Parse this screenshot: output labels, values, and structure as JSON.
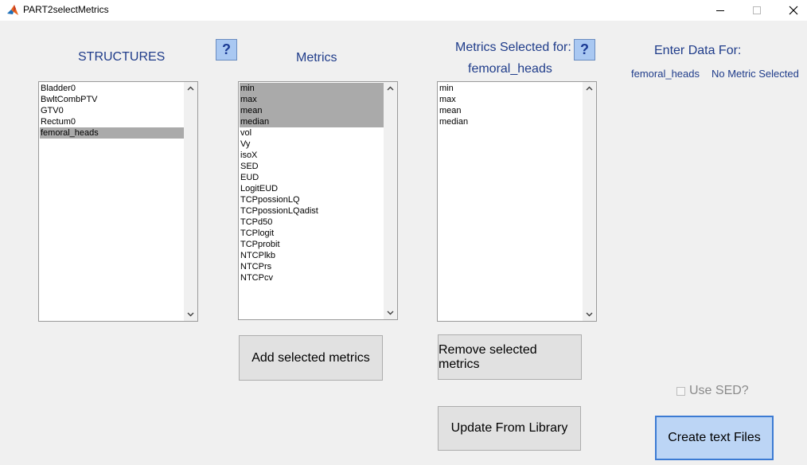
{
  "window": {
    "title": "PART2selectMetrics"
  },
  "labels": {
    "structures": "STRUCTURES",
    "metrics": "Metrics",
    "metrics_selected_for": "Metrics Selected for:",
    "selected_structure": "femoral_heads",
    "enter_data_for": "Enter Data For:",
    "enter_structure": "femoral_heads",
    "no_metric": "No Metric Selected"
  },
  "help": {
    "label": "?"
  },
  "structures_list": {
    "items": [
      "Bladder0",
      "BwltCombPTV",
      "GTV0",
      "Rectum0",
      "femoral_heads"
    ],
    "selected": [
      "femoral_heads"
    ]
  },
  "metrics_list": {
    "items": [
      "min",
      "max",
      "mean",
      "median",
      "vol",
      "Vy",
      "isoX",
      "SED",
      "EUD",
      "LogitEUD",
      "TCPpossionLQ",
      "TCPpossionLQadist",
      "TCPd50",
      "TCPlogit",
      "TCPprobit",
      "NTCPlkb",
      "NTCPrs",
      "NTCPcv"
    ],
    "selected": [
      "min",
      "max",
      "mean",
      "median"
    ]
  },
  "selected_metrics_list": {
    "items": [
      "min",
      "max",
      "mean",
      "median"
    ],
    "selected": []
  },
  "buttons": {
    "add": "Add selected metrics",
    "remove": "Remove selected metrics",
    "update": "Update From Library",
    "create": "Create text Files"
  },
  "use_sed": {
    "label": "Use SED?",
    "checked": false
  },
  "icons": {
    "app": "matlab-icon",
    "minimize": "minimize-icon",
    "maximize": "maximize-icon",
    "close": "close-icon"
  },
  "colors": {
    "label_blue": "#1f3c8a",
    "selection_gray": "#aaaaaa",
    "help_bg": "#a9c8f2",
    "primary_button": "#bcd5f5"
  }
}
